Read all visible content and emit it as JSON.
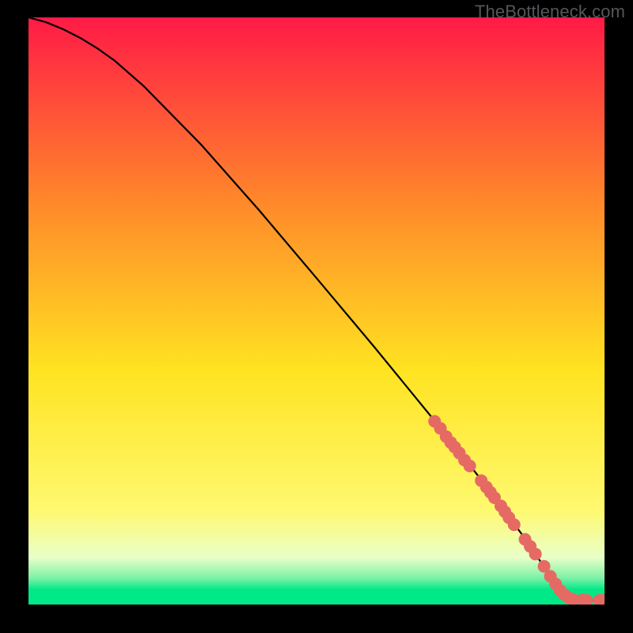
{
  "attribution": "TheBottleneck.com",
  "colors": {
    "grad_top": "#ff1a46",
    "grad_mid_upper": "#ff8a2a",
    "grad_mid": "#ffe321",
    "grad_mid_lower": "#fff970",
    "grad_low": "#e9ffc8",
    "grad_green_top": "#7bf2a6",
    "grad_green": "#00e987",
    "curve": "#000000",
    "marker": "#e66a64",
    "frame": "#000000"
  },
  "chart_data": {
    "type": "line",
    "title": "",
    "xlabel": "",
    "ylabel": "",
    "xlim": [
      0,
      100
    ],
    "ylim": [
      0,
      100
    ],
    "curve": {
      "x": [
        0,
        3,
        6,
        9,
        12,
        15,
        20,
        30,
        40,
        50,
        60,
        70,
        78,
        82,
        86,
        88,
        90,
        92,
        94,
        97,
        100
      ],
      "y": [
        100,
        99.2,
        98,
        96.5,
        94.7,
        92.6,
        88.3,
        78.3,
        67.2,
        55.6,
        43.9,
        31.9,
        22,
        16.8,
        11.5,
        8.6,
        5.7,
        3.1,
        1.4,
        0.7,
        0.7
      ]
    },
    "markers": [
      {
        "x": 70.5,
        "y": 31.2
      },
      {
        "x": 71.5,
        "y": 30.0
      },
      {
        "x": 72.5,
        "y": 28.6
      },
      {
        "x": 73.3,
        "y": 27.6
      },
      {
        "x": 74.0,
        "y": 26.8
      },
      {
        "x": 74.8,
        "y": 25.8
      },
      {
        "x": 75.7,
        "y": 24.6
      },
      {
        "x": 76.6,
        "y": 23.6
      },
      {
        "x": 78.6,
        "y": 21.1
      },
      {
        "x": 79.5,
        "y": 20.0
      },
      {
        "x": 80.2,
        "y": 19.1
      },
      {
        "x": 80.9,
        "y": 18.2
      },
      {
        "x": 82.0,
        "y": 16.8
      },
      {
        "x": 82.7,
        "y": 15.8
      },
      {
        "x": 83.4,
        "y": 14.8
      },
      {
        "x": 84.3,
        "y": 13.6
      },
      {
        "x": 86.2,
        "y": 11.1
      },
      {
        "x": 87.1,
        "y": 9.9
      },
      {
        "x": 88.0,
        "y": 8.6
      },
      {
        "x": 89.5,
        "y": 6.5
      },
      {
        "x": 90.6,
        "y": 4.8
      },
      {
        "x": 91.5,
        "y": 3.5
      },
      {
        "x": 92.3,
        "y": 2.4
      },
      {
        "x": 93.0,
        "y": 1.7
      },
      {
        "x": 93.7,
        "y": 1.2
      },
      {
        "x": 94.5,
        "y": 0.9
      },
      {
        "x": 96.2,
        "y": 0.8
      },
      {
        "x": 96.9,
        "y": 0.7
      },
      {
        "x": 99.1,
        "y": 0.7
      },
      {
        "x": 99.8,
        "y": 0.7
      }
    ]
  }
}
